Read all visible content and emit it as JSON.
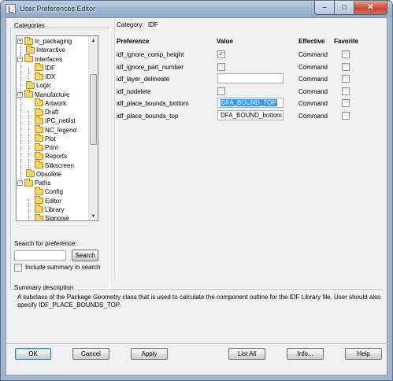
{
  "window": {
    "title": "User Preferences Editor",
    "controls": {
      "minimize": "–",
      "maximize": "□",
      "close": "✕"
    }
  },
  "categories": {
    "label": "Categories",
    "tree": [
      {
        "label": "Ic_packaging",
        "expander": "+",
        "level": 0
      },
      {
        "label": "Interactive",
        "level": 0
      },
      {
        "label": "Interfaces",
        "expander": "−",
        "level": 0
      },
      {
        "label": "IDF",
        "level": 1
      },
      {
        "label": "IDX",
        "level": 1
      },
      {
        "label": "Logic",
        "level": 0
      },
      {
        "label": "Manufacture",
        "expander": "−",
        "level": 0
      },
      {
        "label": "Artwork",
        "level": 1
      },
      {
        "label": "Draft",
        "level": 1
      },
      {
        "label": "IPC_netlist",
        "level": 1
      },
      {
        "label": "NC_legend",
        "level": 1
      },
      {
        "label": "Plot",
        "level": 1
      },
      {
        "label": "Print",
        "level": 1
      },
      {
        "label": "Reports",
        "level": 1
      },
      {
        "label": "Silkscreen",
        "level": 1
      },
      {
        "label": "Obsolete",
        "level": 0
      },
      {
        "label": "Paths",
        "expander": "−",
        "level": 0
      },
      {
        "label": "Config",
        "level": 1
      },
      {
        "label": "Editor",
        "level": 1
      },
      {
        "label": "Library",
        "level": 1
      },
      {
        "label": "Signoise",
        "level": 1
      }
    ],
    "scroll_up": "▲",
    "scroll_down": "▼"
  },
  "search": {
    "label": "Search for preference:",
    "value": "",
    "button": "Search",
    "include_summary_label": "Include summary in search"
  },
  "category_title": {
    "prefix": "Category:",
    "name": "IDF"
  },
  "columns": {
    "preference": "Preference",
    "value": "Value",
    "effective": "Effective",
    "favorite": "Favorite"
  },
  "preferences": [
    {
      "name": "idf_ignore_comp_height",
      "value_type": "checkbox",
      "checked": true,
      "check_mark": "✓",
      "effective": "Command"
    },
    {
      "name": "idf_ignore_part_number",
      "value_type": "checkbox",
      "checked": false,
      "check_mark": "",
      "effective": "Command"
    },
    {
      "name": "idf_layer_delineate",
      "value_type": "text",
      "value": "",
      "effective": "Command"
    },
    {
      "name": "idf_nodelete",
      "value_type": "checkbox",
      "checked": false,
      "check_mark": "",
      "effective": "Command"
    },
    {
      "name": "idf_place_bounds_bottom",
      "value_type": "text",
      "value": "DFA_BOUND_TOP",
      "selected": true,
      "effective": "Command"
    },
    {
      "name": "idf_place_bounds_top",
      "value_type": "text",
      "value": "DFA_BOUND_bottom",
      "effective": "Command"
    }
  ],
  "summary": {
    "label": "Summary description",
    "text_line1": "A subclass of the Package Geometry class that is used to calculate the component outline for the IDF Library file.  User should also",
    "text_line2": "specify IDF_PLACE_BOUNDS_TOP."
  },
  "buttons": {
    "ok": "OK",
    "cancel": "Cancel",
    "apply": "Apply",
    "list_all": "List All",
    "info": "Info...",
    "help": "Help"
  },
  "colors": {
    "titlebar": "#9db6cf",
    "selection": "#3399ff",
    "folder": "#f3d66b"
  }
}
